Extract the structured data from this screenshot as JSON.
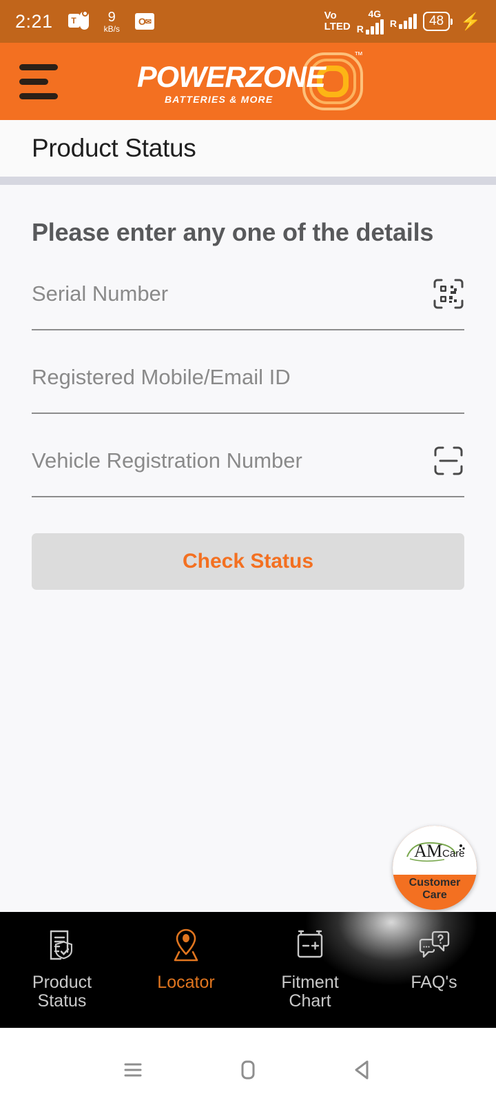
{
  "statusbar": {
    "clock": "2:21",
    "teams_icon": "microsoft-teams-icon",
    "network_speed_value": "9",
    "network_speed_unit": "kB/s",
    "outlook_icon": "outlook-icon",
    "volte_line1": "Vo",
    "volte_line2": "LTED",
    "sim1_roaming": "R",
    "sim1_network": "4G",
    "sim2_roaming": "R",
    "battery_level": "48",
    "charging_icon": "charging-bolt-icon"
  },
  "appbar": {
    "menu_icon": "hamburger-menu-icon",
    "logo_word_1": "POWER",
    "logo_word_2": "ZONE",
    "logo_tagline": "BATTERIES & MORE",
    "logo_tm": "™"
  },
  "page": {
    "title": "Product Status"
  },
  "form": {
    "heading": "Please enter any one of the details",
    "fields": [
      {
        "name": "serial-number",
        "placeholder": "Serial Number",
        "value": "",
        "icon": "qr-code-scan-icon"
      },
      {
        "name": "registered-mobile-email",
        "placeholder": "Registered Mobile/Email ID",
        "value": "",
        "icon": ""
      },
      {
        "name": "vehicle-registration-number",
        "placeholder": "Vehicle Registration Number",
        "value": "",
        "icon": "text-scan-icon"
      }
    ],
    "submit_label": "Check Status",
    "submit_text_color": "#f37021",
    "submit_bg_color": "#dcdcdc"
  },
  "care_fab": {
    "logo_text": "AMCare",
    "label_line1": "Customer",
    "label_line2": "Care"
  },
  "bottomnav": {
    "active_index": 1,
    "active_color": "#e0751f",
    "inactive_color": "#c9c9c9",
    "items": [
      {
        "name": "product-status",
        "line1": "Product",
        "line2": "Status",
        "icon": "document-shield-check-icon"
      },
      {
        "name": "locator",
        "line1": "Locator",
        "line2": "",
        "icon": "map-pin-icon"
      },
      {
        "name": "fitment-chart",
        "line1": "Fitment",
        "line2": "Chart",
        "icon": "battery-icon"
      },
      {
        "name": "faqs",
        "line1": "FAQ's",
        "line2": "",
        "icon": "chat-question-icon"
      }
    ]
  },
  "androidnav": {
    "recents_icon": "recents-icon",
    "home_icon": "home-icon",
    "back_icon": "back-icon"
  },
  "colors": {
    "brand_orange": "#f37021",
    "statusbar_orange": "#c1651b",
    "page_bg": "#f8f8fa",
    "divider": "#d6d7e0"
  }
}
